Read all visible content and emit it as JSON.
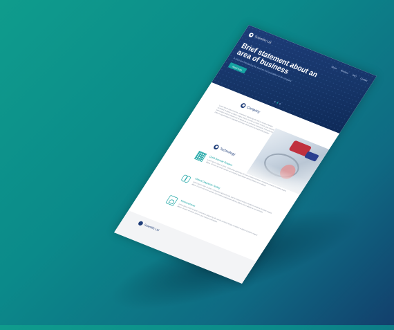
{
  "hero": {
    "brand": "Scientific Ltd",
    "nav": [
      "About",
      "Services",
      "FAQ",
      "Contact"
    ],
    "title": "Brief statement about an area of business",
    "subtitle": "A short text introducing the services and specialities of the company",
    "button": "Read more"
  },
  "company": {
    "title": "Company",
    "text": "Lorem ipsum dolor sit amet, consectetur adipiscing elit, sed do eiusmod tempor incididunt ut labore et dolore magna aliqua. Ut enim ad minim veniam, quis nostrud exercitation ullamco laboris nisi ut aliquip ex ea commodo consequat. Duis aute irure dolor in reprehenderit in voluptate velit esse cillum dolore eu fugiat nulla pariatur."
  },
  "technology": {
    "title": "Technology",
    "features": [
      {
        "icon": "qr-icon",
        "title": "Quick Barcode Readers",
        "text": "Lorem ipsum dolor sit amet, consectetur adipiscing elit, sed do eiusmod tempor incididunt ut labore et dolore magna aliqua. Ut enim ad minim veniam, quis nostrud exercitation ullamco laboris nisi ut aliquip."
      },
      {
        "icon": "lungs-icon",
        "title": "Clinical Diagnostic Testing",
        "text": "Lorem ipsum dolor sit amet, consectetur adipiscing elit, sed do eiusmod tempor incididunt ut labore et dolore magna aliqua. Ut enim ad minim veniam, quis nostrud exercitation ullamco laboris nisi ut aliquip ex ea commodo."
      },
      {
        "icon": "scale-icon",
        "title": "Measurements",
        "text": "Lorem ipsum dolor sit amet, consectetur adipiscing elit, sed do eiusmod tempor incididunt ut labore et dolore magna aliqua. Ut enim ad minim veniam, quis nostrud exercitation."
      }
    ]
  },
  "footer": {
    "brand": "Scientific Ltd"
  },
  "colors": {
    "navy": "#1d3c78",
    "teal": "#16a3a2",
    "bg_teal": "#0f9c8c",
    "bg_blue": "#123f6c"
  }
}
